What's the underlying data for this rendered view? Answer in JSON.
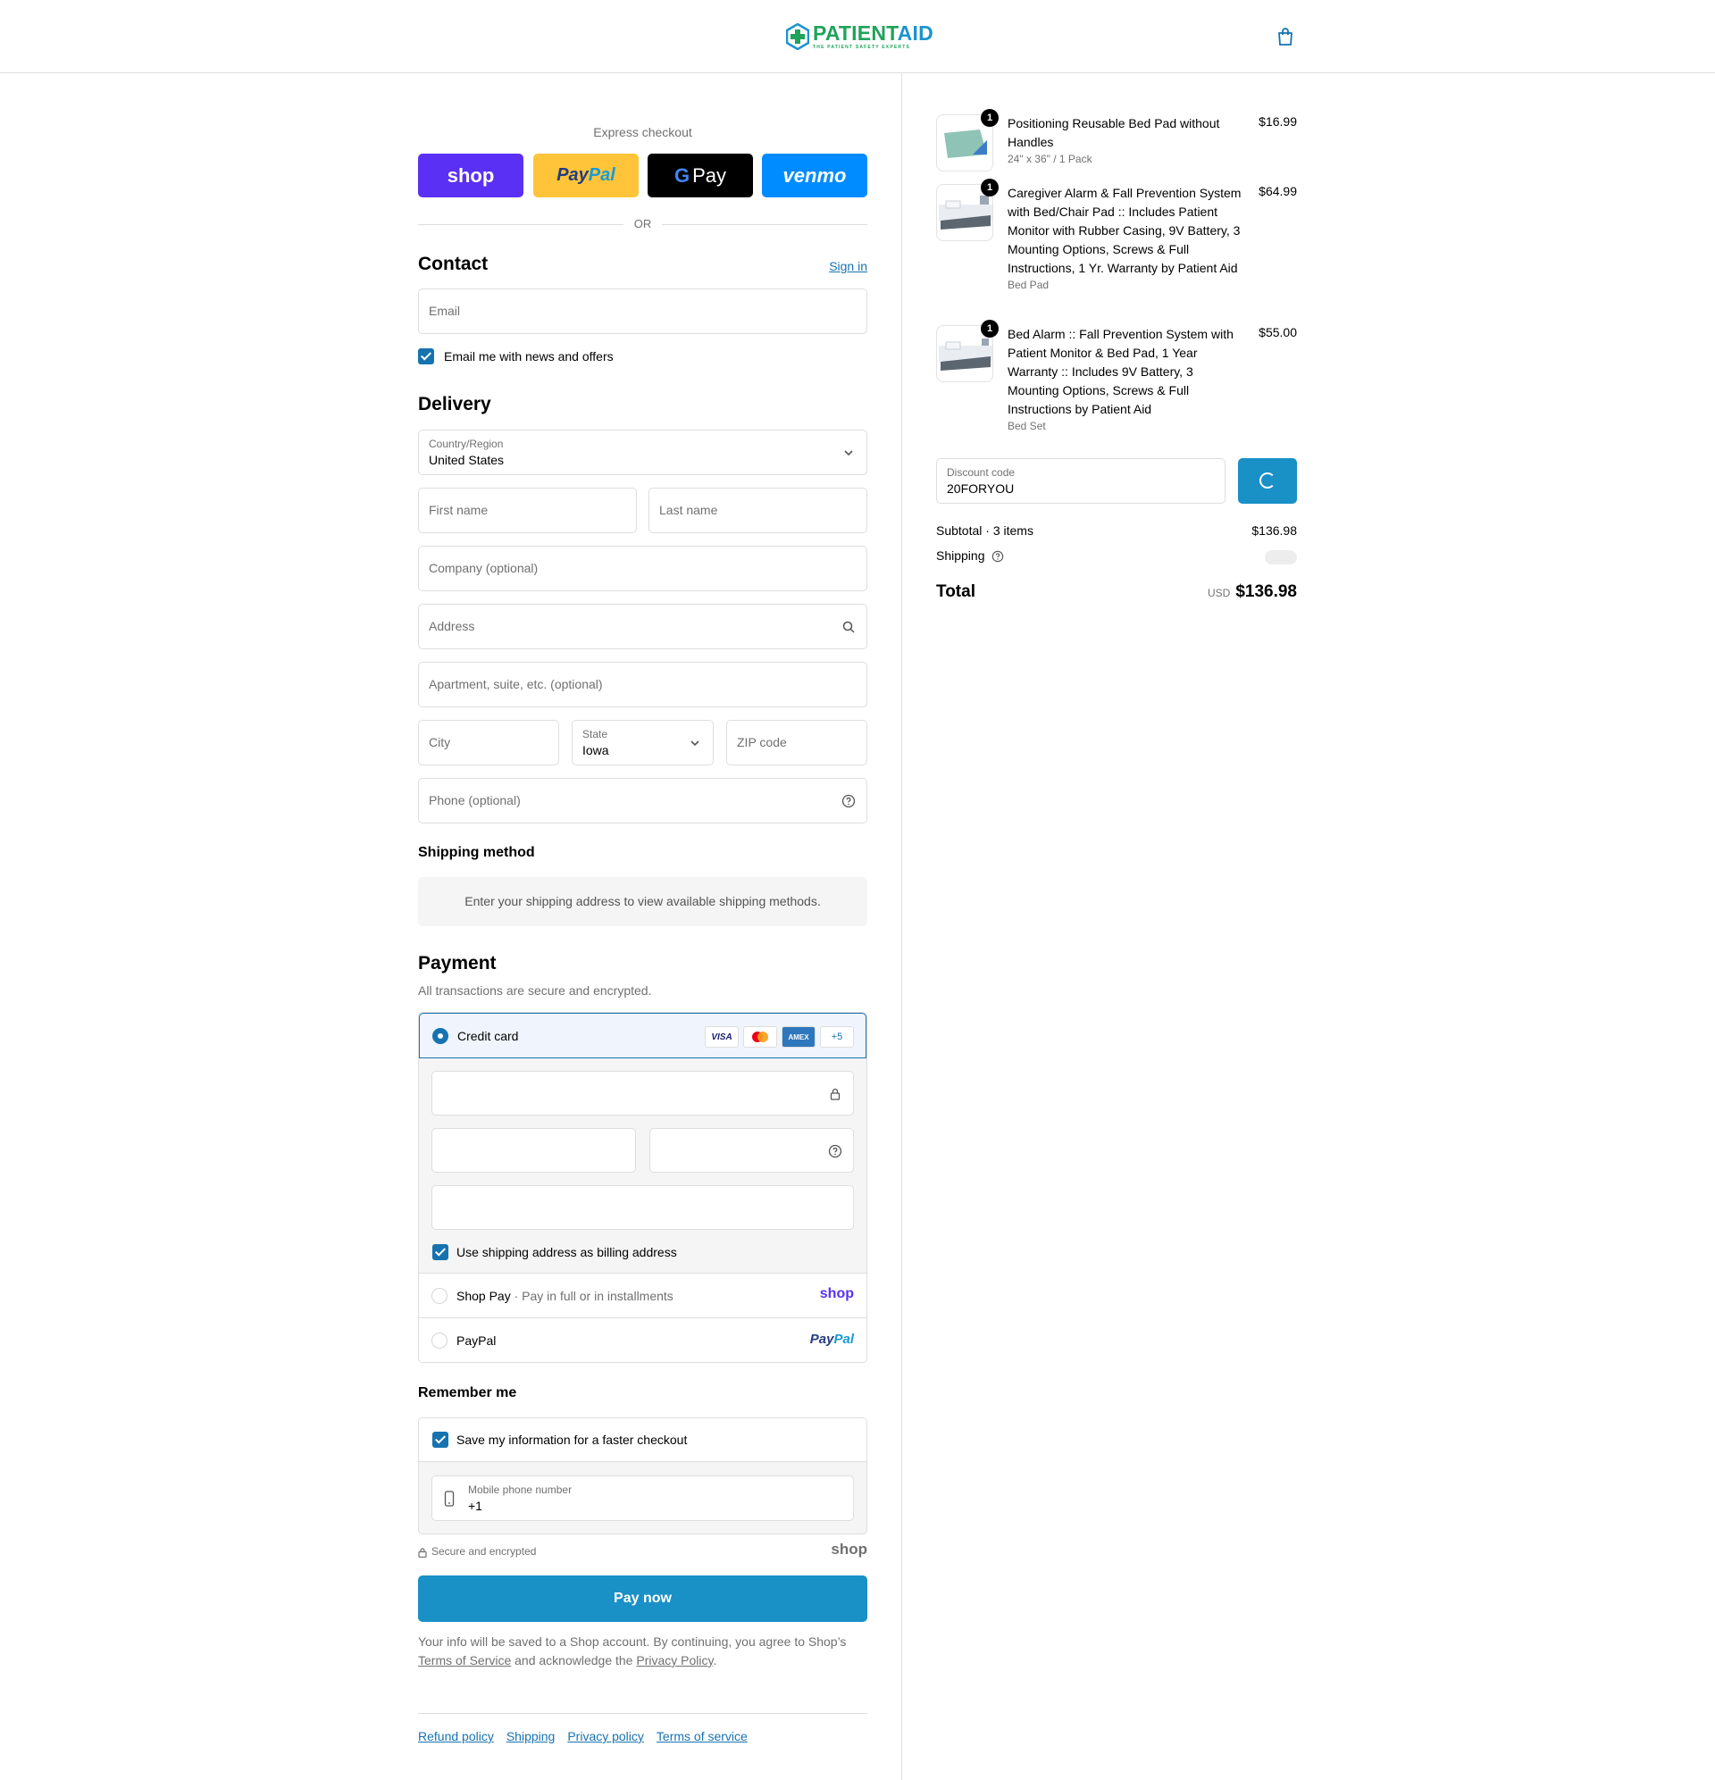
{
  "header": {
    "logo_word_1": "PATIENT",
    "logo_word_2": "AID",
    "logo_tagline": "THE PATIENT SAFETY EXPERTS"
  },
  "express": {
    "label": "Express checkout",
    "shop_label": "shop",
    "paypal_label_1": "Pay",
    "paypal_label_2": "Pal",
    "gpay_label": "Pay",
    "venmo_label": "venmo",
    "or_label": "OR"
  },
  "contact": {
    "title": "Contact",
    "sign_in": "Sign in",
    "email_placeholder": "Email",
    "news_checkbox": "Email me with news and offers"
  },
  "delivery": {
    "title": "Delivery",
    "country_label": "Country/Region",
    "country_value": "United States",
    "first_name": "First name",
    "last_name": "Last name",
    "company": "Company (optional)",
    "address": "Address",
    "apartment": "Apartment, suite, etc. (optional)",
    "city": "City",
    "state_label": "State",
    "state_value": "Iowa",
    "zip": "ZIP code",
    "phone": "Phone (optional)"
  },
  "shipping_method": {
    "title": "Shipping method",
    "info": "Enter your shipping address to view available shipping methods."
  },
  "payment": {
    "title": "Payment",
    "subtitle": "All transactions are secure and encrypted.",
    "credit_card": "Credit card",
    "card_brands": [
      "VISA",
      "MC",
      "AMEX",
      "+5"
    ],
    "billing_checkbox": "Use shipping address as billing address",
    "shop_pay": "Shop Pay",
    "shop_pay_sub": "Pay in full or in installments",
    "shop_pay_logo": "shop",
    "paypal": "PayPal",
    "paypal_logo_1": "Pay",
    "paypal_logo_2": "Pal"
  },
  "remember": {
    "title": "Remember me",
    "save_checkbox": "Save my information for a faster checkout",
    "mobile_label": "Mobile phone number",
    "mobile_value": "+1",
    "secure_text": "Secure and encrypted",
    "shop_logo": "shop"
  },
  "pay_now": "Pay now",
  "legal": {
    "text_1": "Your info will be saved to a Shop account. By continuing, you agree to Shop’s",
    "terms": "Terms of Service",
    "text_2": "and acknowledge the",
    "privacy": "Privacy Policy",
    "text_3": "."
  },
  "footer_links": [
    "Refund policy",
    "Shipping",
    "Privacy policy",
    "Terms of service"
  ],
  "cart": {
    "items": [
      {
        "qty": "1",
        "name": "Positioning Reusable Bed Pad without Handles",
        "variant": "24\" x 36\" / 1 Pack",
        "price": "$16.99"
      },
      {
        "qty": "1",
        "name": "Caregiver Alarm & Fall Prevention System with Bed/Chair Pad :: Includes Patient Monitor with Rubber Casing, 9V Battery, 3 Mounting Options, Screws & Full Instructions, 1 Yr. Warranty by Patient Aid",
        "variant": "Bed Pad",
        "price": "$64.99"
      },
      {
        "qty": "1",
        "name": "Bed Alarm :: Fall Prevention System with Patient Monitor & Bed Pad, 1 Year Warranty :: Includes 9V Battery, 3 Mounting Options, Screws & Full Instructions by Patient Aid",
        "variant": "Bed Set",
        "price": "$55.00"
      }
    ],
    "discount_label": "Discount code",
    "discount_value": "20FORYOU",
    "subtotal_label": "Subtotal · 3 items",
    "subtotal_value": "$136.98",
    "shipping_label": "Shipping",
    "total_label": "Total",
    "total_currency": "USD",
    "total_value": "$136.98"
  },
  "colors": {
    "accent": "#1773b0",
    "button": "#1990c6",
    "shop_purple": "#5a31f4",
    "paypal_yellow": "#ffc439",
    "venmo_blue": "#008cff"
  }
}
